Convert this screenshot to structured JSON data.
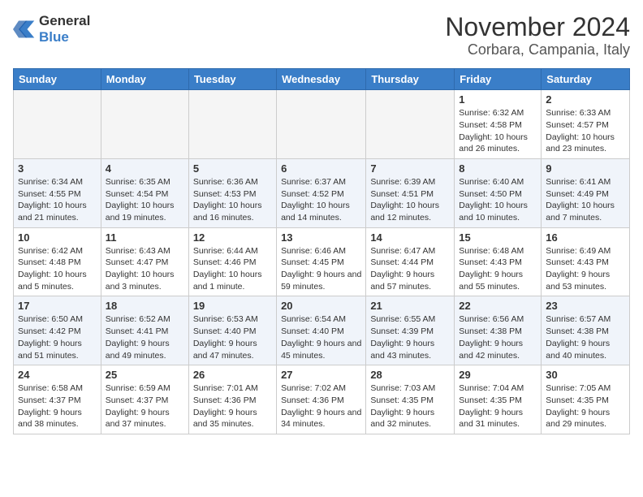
{
  "logo": {
    "general": "General",
    "blue": "Blue"
  },
  "title": "November 2024",
  "subtitle": "Corbara, Campania, Italy",
  "weekdays": [
    "Sunday",
    "Monday",
    "Tuesday",
    "Wednesday",
    "Thursday",
    "Friday",
    "Saturday"
  ],
  "weeks": [
    [
      {
        "day": "",
        "info": ""
      },
      {
        "day": "",
        "info": ""
      },
      {
        "day": "",
        "info": ""
      },
      {
        "day": "",
        "info": ""
      },
      {
        "day": "",
        "info": ""
      },
      {
        "day": "1",
        "info": "Sunrise: 6:32 AM\nSunset: 4:58 PM\nDaylight: 10 hours and 26 minutes."
      },
      {
        "day": "2",
        "info": "Sunrise: 6:33 AM\nSunset: 4:57 PM\nDaylight: 10 hours and 23 minutes."
      }
    ],
    [
      {
        "day": "3",
        "info": "Sunrise: 6:34 AM\nSunset: 4:55 PM\nDaylight: 10 hours and 21 minutes."
      },
      {
        "day": "4",
        "info": "Sunrise: 6:35 AM\nSunset: 4:54 PM\nDaylight: 10 hours and 19 minutes."
      },
      {
        "day": "5",
        "info": "Sunrise: 6:36 AM\nSunset: 4:53 PM\nDaylight: 10 hours and 16 minutes."
      },
      {
        "day": "6",
        "info": "Sunrise: 6:37 AM\nSunset: 4:52 PM\nDaylight: 10 hours and 14 minutes."
      },
      {
        "day": "7",
        "info": "Sunrise: 6:39 AM\nSunset: 4:51 PM\nDaylight: 10 hours and 12 minutes."
      },
      {
        "day": "8",
        "info": "Sunrise: 6:40 AM\nSunset: 4:50 PM\nDaylight: 10 hours and 10 minutes."
      },
      {
        "day": "9",
        "info": "Sunrise: 6:41 AM\nSunset: 4:49 PM\nDaylight: 10 hours and 7 minutes."
      }
    ],
    [
      {
        "day": "10",
        "info": "Sunrise: 6:42 AM\nSunset: 4:48 PM\nDaylight: 10 hours and 5 minutes."
      },
      {
        "day": "11",
        "info": "Sunrise: 6:43 AM\nSunset: 4:47 PM\nDaylight: 10 hours and 3 minutes."
      },
      {
        "day": "12",
        "info": "Sunrise: 6:44 AM\nSunset: 4:46 PM\nDaylight: 10 hours and 1 minute."
      },
      {
        "day": "13",
        "info": "Sunrise: 6:46 AM\nSunset: 4:45 PM\nDaylight: 9 hours and 59 minutes."
      },
      {
        "day": "14",
        "info": "Sunrise: 6:47 AM\nSunset: 4:44 PM\nDaylight: 9 hours and 57 minutes."
      },
      {
        "day": "15",
        "info": "Sunrise: 6:48 AM\nSunset: 4:43 PM\nDaylight: 9 hours and 55 minutes."
      },
      {
        "day": "16",
        "info": "Sunrise: 6:49 AM\nSunset: 4:43 PM\nDaylight: 9 hours and 53 minutes."
      }
    ],
    [
      {
        "day": "17",
        "info": "Sunrise: 6:50 AM\nSunset: 4:42 PM\nDaylight: 9 hours and 51 minutes."
      },
      {
        "day": "18",
        "info": "Sunrise: 6:52 AM\nSunset: 4:41 PM\nDaylight: 9 hours and 49 minutes."
      },
      {
        "day": "19",
        "info": "Sunrise: 6:53 AM\nSunset: 4:40 PM\nDaylight: 9 hours and 47 minutes."
      },
      {
        "day": "20",
        "info": "Sunrise: 6:54 AM\nSunset: 4:40 PM\nDaylight: 9 hours and 45 minutes."
      },
      {
        "day": "21",
        "info": "Sunrise: 6:55 AM\nSunset: 4:39 PM\nDaylight: 9 hours and 43 minutes."
      },
      {
        "day": "22",
        "info": "Sunrise: 6:56 AM\nSunset: 4:38 PM\nDaylight: 9 hours and 42 minutes."
      },
      {
        "day": "23",
        "info": "Sunrise: 6:57 AM\nSunset: 4:38 PM\nDaylight: 9 hours and 40 minutes."
      }
    ],
    [
      {
        "day": "24",
        "info": "Sunrise: 6:58 AM\nSunset: 4:37 PM\nDaylight: 9 hours and 38 minutes."
      },
      {
        "day": "25",
        "info": "Sunrise: 6:59 AM\nSunset: 4:37 PM\nDaylight: 9 hours and 37 minutes."
      },
      {
        "day": "26",
        "info": "Sunrise: 7:01 AM\nSunset: 4:36 PM\nDaylight: 9 hours and 35 minutes."
      },
      {
        "day": "27",
        "info": "Sunrise: 7:02 AM\nSunset: 4:36 PM\nDaylight: 9 hours and 34 minutes."
      },
      {
        "day": "28",
        "info": "Sunrise: 7:03 AM\nSunset: 4:35 PM\nDaylight: 9 hours and 32 minutes."
      },
      {
        "day": "29",
        "info": "Sunrise: 7:04 AM\nSunset: 4:35 PM\nDaylight: 9 hours and 31 minutes."
      },
      {
        "day": "30",
        "info": "Sunrise: 7:05 AM\nSunset: 4:35 PM\nDaylight: 9 hours and 29 minutes."
      }
    ]
  ]
}
